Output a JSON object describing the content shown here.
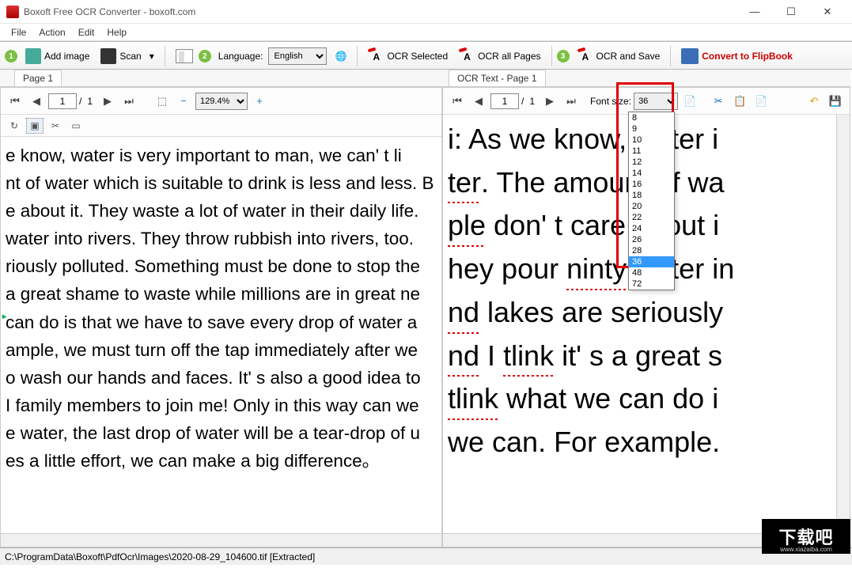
{
  "window": {
    "title": "Boxoft Free OCR Converter - boxoft.com",
    "controls": {
      "min": "—",
      "max": "☐",
      "close": "✕"
    }
  },
  "menu": {
    "file": "File",
    "action": "Action",
    "edit": "Edit",
    "help": "Help"
  },
  "toolbar": {
    "step1": "1",
    "add_image": "Add image",
    "scan": "Scan",
    "step2": "2",
    "language_label": "Language:",
    "language_value": "English",
    "ocr_selected": "OCR Selected",
    "ocr_all": "OCR all Pages",
    "step3": "3",
    "ocr_save": "OCR and Save",
    "convert": "Convert to FlipBook"
  },
  "left_panel": {
    "tab": "Page 1",
    "page_current": "1",
    "page_sep": "/",
    "page_total": "1",
    "zoom_value": "129.4%",
    "text": "e know, water is very important to man, we can' t li\nnt of water which is suitable to drink is less and less. B\ne about it. They waste a lot of water in their daily life.\nwater into rivers. They throw rubbish into rivers, too.\nriously polluted. Something must be done to stop the\na great shame to waste while millions are in great ne\ncan do is that we have to save every drop of water a\nample, we must turn off the tap immediately after we\no wash our hands and faces. It' s also a good idea to\nI family members to join me! Only in this way can we\ne water, the last drop of water will be a tear-drop of u\nes a little effort, we can make a big difference。"
  },
  "right_panel": {
    "tab": "OCR Text - Page 1",
    "page_current": "1",
    "page_sep": "/",
    "page_total": "1",
    "font_size_label": "Font size:",
    "font_size_value": "36",
    "text": "i: As we know, water i\nter. The amount of wa\nple don' t care about i\nhey pour ninty water in\nnd lakes are seriously\nnd I tlink it' s a great s\ntlink what we can do i\nwe can. For example."
  },
  "font_options": [
    "8",
    "9",
    "10",
    "11",
    "12",
    "14",
    "16",
    "18",
    "20",
    "22",
    "24",
    "26",
    "28",
    "36",
    "48",
    "72"
  ],
  "font_selected": "36",
  "statusbar": {
    "path": "C:\\ProgramData\\Boxoft\\PdfOcr\\Images\\2020-08-29_104600.tif [Extracted]"
  },
  "watermark": {
    "text": "下载吧",
    "sub": "www.xiazaiba.com"
  }
}
